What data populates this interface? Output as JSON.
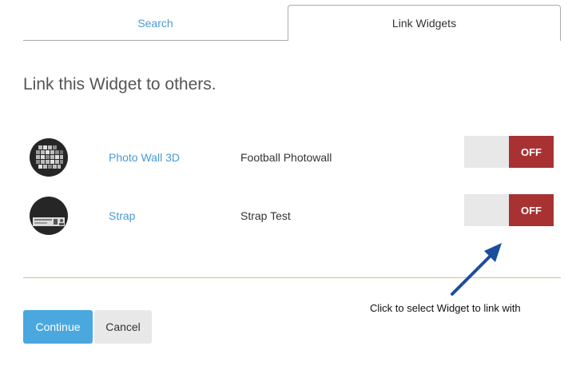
{
  "tabs": [
    {
      "label": "Search",
      "active": false
    },
    {
      "label": "Link Widgets",
      "active": true
    }
  ],
  "heading": "Link this Widget to others.",
  "widgets": [
    {
      "name": "Photo Wall 3D",
      "description": "Football Photowall",
      "toggle_state": "OFF",
      "icon": "photo-wall-grid-icon"
    },
    {
      "name": "Strap",
      "description": "Strap Test",
      "toggle_state": "OFF",
      "icon": "strap-banner-icon"
    }
  ],
  "annotation": "Click to select Widget to link with",
  "buttons": {
    "continue_label": "Continue",
    "cancel_label": "Cancel"
  },
  "colors": {
    "accent": "#4a9ad4",
    "toggle_off": "#a83232",
    "annotation_arrow": "#1a4f9c",
    "divider": "#d8c866"
  }
}
